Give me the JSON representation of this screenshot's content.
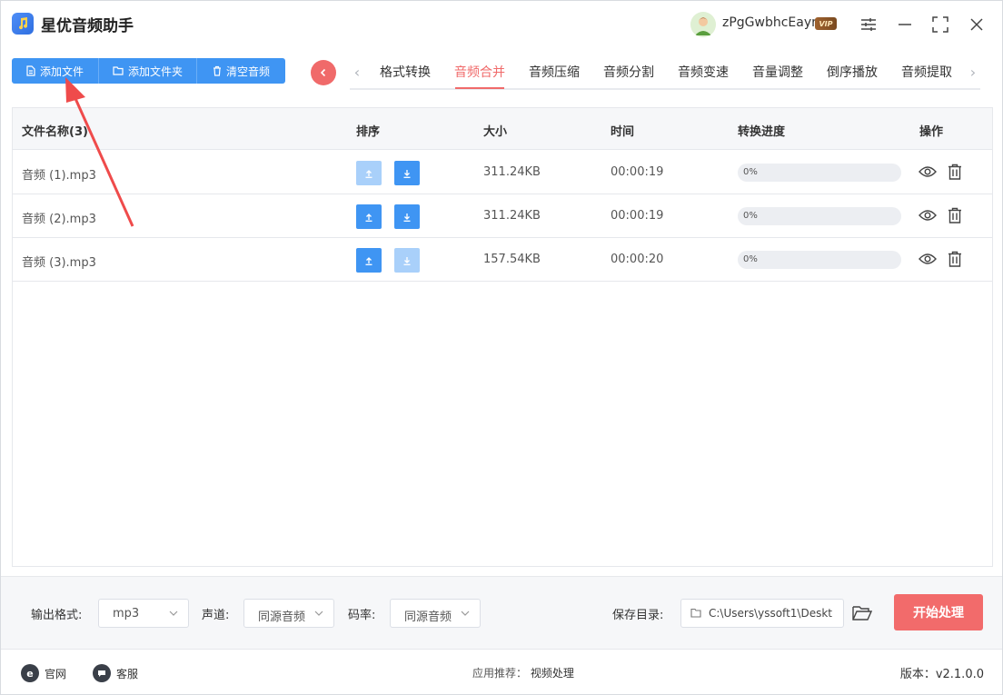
{
  "app": {
    "title": "星优音频助手",
    "user_name": "zPgGwbhcEayr",
    "vip_label": "VIP"
  },
  "toolbar": {
    "add_file": "添加文件",
    "add_folder": "添加文件夹",
    "clear_audio": "清空音频"
  },
  "tabs": [
    {
      "label": "格式转换",
      "active": false
    },
    {
      "label": "音频合并",
      "active": true
    },
    {
      "label": "音频压缩",
      "active": false
    },
    {
      "label": "音频分割",
      "active": false
    },
    {
      "label": "音频变速",
      "active": false
    },
    {
      "label": "音量调整",
      "active": false
    },
    {
      "label": "倒序播放",
      "active": false
    },
    {
      "label": "音频提取",
      "active": false
    }
  ],
  "table": {
    "headers": {
      "name": "文件名称(3)",
      "sort": "排序",
      "size": "大小",
      "time": "时间",
      "progress": "转换进度",
      "action": "操作"
    },
    "rows": [
      {
        "name": "音频 (1).mp3",
        "size": "311.24KB",
        "time": "00:00:19",
        "progress_text": "0%",
        "progress": 0,
        "up_enabled": false,
        "down_enabled": true
      },
      {
        "name": "音频 (2).mp3",
        "size": "311.24KB",
        "time": "00:00:19",
        "progress_text": "0%",
        "progress": 0,
        "up_enabled": true,
        "down_enabled": true
      },
      {
        "name": "音频 (3).mp3",
        "size": "157.54KB",
        "time": "00:00:20",
        "progress_text": "0%",
        "progress": 0,
        "up_enabled": true,
        "down_enabled": false
      }
    ]
  },
  "settings": {
    "format_label": "输出格式:",
    "format_value": "mp3",
    "channel_label": "声道:",
    "channel_value": "同源音频",
    "bitrate_label": "码率:",
    "bitrate_value": "同源音频",
    "save_label": "保存目录:",
    "save_path": "C:\\Users\\yssoft1\\Deskt",
    "start_label": "开始处理"
  },
  "footer": {
    "website": "官网",
    "support": "客服",
    "rec_label": "应用推荐：",
    "rec_link": "视频处理",
    "version": "版本：v2.1.0.0"
  },
  "colors": {
    "primary": "#3f95f3",
    "accent_red": "#f06a6a",
    "start_button": "#f26b6b"
  }
}
